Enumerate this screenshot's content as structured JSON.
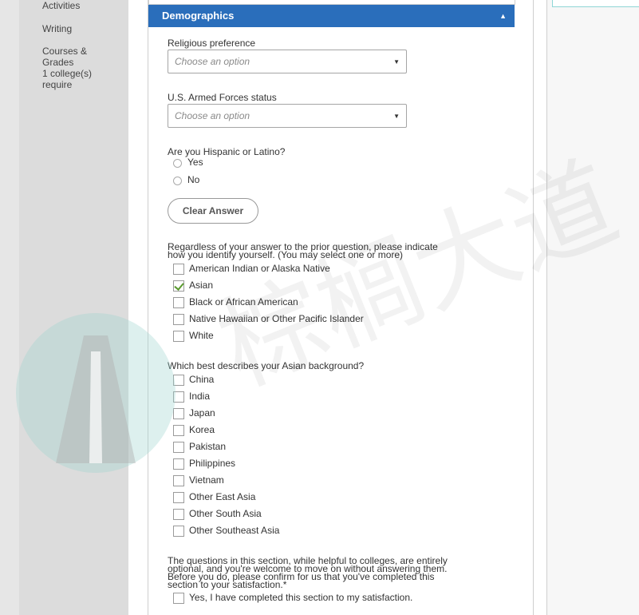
{
  "sidebar": {
    "items": [
      {
        "label": "Activities"
      },
      {
        "label": "Writing"
      },
      {
        "label": "Courses &"
      },
      {
        "label": "Grades"
      },
      {
        "label": "1 college(s)"
      },
      {
        "label": "require"
      }
    ]
  },
  "section": {
    "title": "Demographics",
    "collapse_icon": "chevron-up-icon"
  },
  "religious": {
    "label": "Religious preference",
    "placeholder": "Choose an option"
  },
  "armed_forces": {
    "label": "U.S. Armed Forces status",
    "placeholder": "Choose an option"
  },
  "hispanic": {
    "question": "Are you Hispanic or Latino?",
    "options": [
      "Yes",
      "No"
    ],
    "clear_label": "Clear Answer"
  },
  "race": {
    "question_line1": "Regardless of your answer to the prior question, please indicate",
    "question_line2": "how you identify yourself. (You may select one or more)",
    "options": [
      {
        "label": "American Indian or Alaska Native",
        "checked": false
      },
      {
        "label": "Asian",
        "checked": true
      },
      {
        "label": "Black or African American",
        "checked": false
      },
      {
        "label": "Native Hawaiian or Other Pacific Islander",
        "checked": false
      },
      {
        "label": "White",
        "checked": false
      }
    ]
  },
  "asian_background": {
    "question": "Which best describes your Asian background?",
    "options": [
      {
        "label": "China",
        "checked": false
      },
      {
        "label": "India",
        "checked": false
      },
      {
        "label": "Japan",
        "checked": false
      },
      {
        "label": "Korea",
        "checked": false
      },
      {
        "label": "Pakistan",
        "checked": false
      },
      {
        "label": "Philippines",
        "checked": false
      },
      {
        "label": "Vietnam",
        "checked": false
      },
      {
        "label": "Other East Asia",
        "checked": false
      },
      {
        "label": "Other South Asia",
        "checked": false
      },
      {
        "label": "Other Southeast Asia",
        "checked": false
      }
    ]
  },
  "confirm": {
    "line1": "The questions in this section, while helpful to colleges, are entirely",
    "line2": "optional, and you're welcome to move on without answering them.",
    "line3": "Before you do, please confirm for us that you've completed this",
    "line4": "section to your satisfaction.*",
    "checkbox_label": "Yes, I have completed this section to my satisfaction.",
    "checked": false
  },
  "watermark": {
    "text": "棕榈大道",
    "colors": {
      "teal": "#9fd3cf",
      "grey": "#b0b0b0"
    }
  },
  "colors": {
    "header_blue": "#2a6ebb",
    "check_green": "#5a9a2e"
  }
}
